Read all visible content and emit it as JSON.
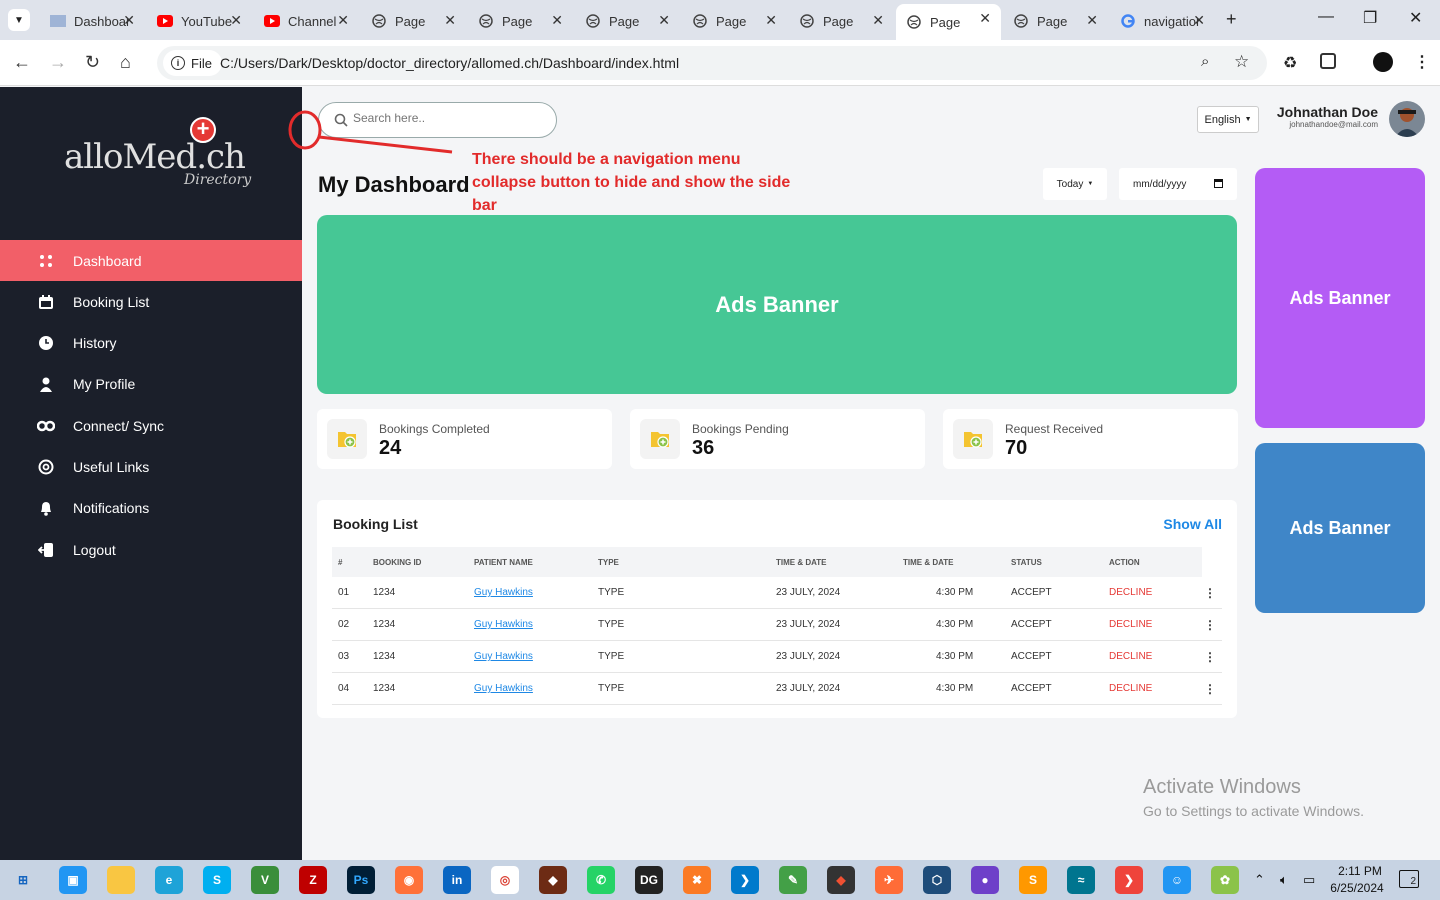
{
  "browser": {
    "tabs": [
      {
        "title": "Dashboard",
        "icon": "dashboard-favicon"
      },
      {
        "title": "YouTube",
        "icon": "youtube-icon"
      },
      {
        "title": "Channel",
        "icon": "youtube-icon"
      },
      {
        "title": "Page",
        "icon": "globe-icon"
      },
      {
        "title": "Page",
        "icon": "globe-icon"
      },
      {
        "title": "Page",
        "icon": "globe-icon"
      },
      {
        "title": "Page",
        "icon": "globe-icon"
      },
      {
        "title": "Page",
        "icon": "globe-icon"
      },
      {
        "title": "Page",
        "icon": "globe-icon",
        "active": true
      },
      {
        "title": "Page",
        "icon": "globe-icon"
      },
      {
        "title": "navigation",
        "icon": "google-icon"
      }
    ],
    "file_chip": "File",
    "url": "C:/Users/Dark/Desktop/doctor_directory/allomed.ch/Dashboard/index.html"
  },
  "sidebar": {
    "logo_text": "alloMed.ch",
    "logo_sub": "Directory",
    "items": [
      {
        "label": "Dashboard",
        "icon": "grid-dots-icon",
        "active": true
      },
      {
        "label": "Booking List",
        "icon": "calendar-icon"
      },
      {
        "label": "History",
        "icon": "clock-icon"
      },
      {
        "label": "My Profile",
        "icon": "user-icon"
      },
      {
        "label": "Connect/ Sync",
        "icon": "link-icon"
      },
      {
        "label": "Useful Links",
        "icon": "at-icon"
      },
      {
        "label": "Notifications",
        "icon": "bell-icon"
      },
      {
        "label": "Logout",
        "icon": "logout-icon"
      }
    ]
  },
  "header": {
    "search_placeholder": "Search here..",
    "language": "English",
    "user_name": "Johnathan Doe",
    "user_email": "johnathandoe@mail.com"
  },
  "annotation": {
    "text": "There should be a navigation menu collapse button to hide and show the side bar",
    "color": "#e22b2b"
  },
  "dashboard": {
    "title": "My Dashboard",
    "period": "Today",
    "date_placeholder": "mm/dd/yyyy",
    "banners": [
      {
        "label": "Ads Banner",
        "color": "#46c795"
      },
      {
        "label": "Ads Banner",
        "color": "#b45cf5"
      },
      {
        "label": "Ads Banner",
        "color": "#3f86c8"
      }
    ],
    "stats": [
      {
        "label": "Bookings Completed",
        "value": "24"
      },
      {
        "label": "Bookings Pending",
        "value": "36"
      },
      {
        "label": "Request Received",
        "value": "70"
      }
    ],
    "booking_list": {
      "title": "Booking List",
      "show_all": "Show All",
      "columns": [
        "#",
        "BOOKING ID",
        "PATIENT NAME",
        "TYPE",
        "TIME & DATE",
        "TIME & DATE",
        "STATUS",
        "ACTION"
      ],
      "rows": [
        {
          "num": "01",
          "id": "1234",
          "patient": "Guy Hawkins",
          "type": "TYPE",
          "date": "23 JULY, 2024",
          "time": "4:30 PM",
          "status": "ACCEPT",
          "action": "DECLINE"
        },
        {
          "num": "02",
          "id": "1234",
          "patient": "Guy Hawkins",
          "type": "TYPE",
          "date": "23 JULY, 2024",
          "time": "4:30 PM",
          "status": "ACCEPT",
          "action": "DECLINE"
        },
        {
          "num": "03",
          "id": "1234",
          "patient": "Guy Hawkins",
          "type": "TYPE",
          "date": "23 JULY, 2024",
          "time": "4:30 PM",
          "status": "ACCEPT",
          "action": "DECLINE"
        },
        {
          "num": "04",
          "id": "1234",
          "patient": "Guy Hawkins",
          "type": "TYPE",
          "date": "23 JULY, 2024",
          "time": "4:30 PM",
          "status": "ACCEPT",
          "action": "DECLINE"
        }
      ]
    }
  },
  "watermark": {
    "line1": "Activate Windows",
    "line2": "Go to Settings to activate Windows."
  },
  "taskbar": {
    "time": "2:11 PM",
    "date": "6/25/2024",
    "notification_count": "2"
  },
  "colors": {
    "sidebar_bg": "#1b1f2a",
    "active_nav": "#f25f68",
    "link": "#1e88e5",
    "decline": "#e53935"
  }
}
